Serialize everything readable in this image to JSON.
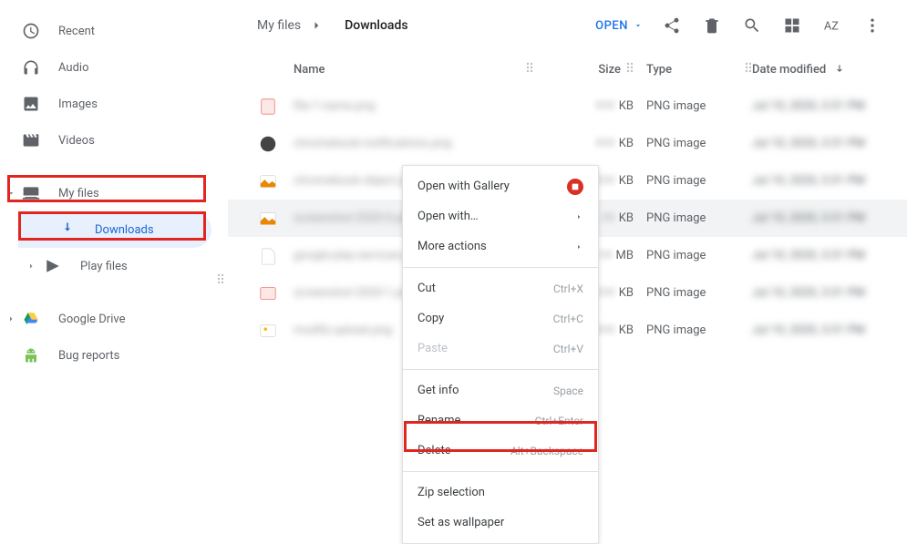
{
  "sidebar": {
    "recent": "Recent",
    "audio": "Audio",
    "images": "Images",
    "videos": "Videos",
    "myfiles": "My files",
    "downloads": "Downloads",
    "playfiles": "Play files",
    "gdrive": "Google Drive",
    "bugreports": "Bug reports"
  },
  "breadcrumb": {
    "root": "My files",
    "current": "Downloads"
  },
  "toolbar": {
    "open": "OPEN"
  },
  "columns": {
    "name": "Name",
    "size": "Size",
    "type": "Type",
    "date": "Date modified"
  },
  "files": [
    {
      "name": "file-1-name.png",
      "size_val": "000",
      "size_unit": "KB",
      "type": "PNG image",
      "date": "Jul 10, 2020, 3:31 PM"
    },
    {
      "name": "chromebook-notifications.png",
      "size_val": "000",
      "size_unit": "KB",
      "type": "PNG image",
      "date": "Jul 10, 2020, 3:31 PM"
    },
    {
      "name": "chromebook-object.png",
      "size_val": "000",
      "size_unit": "KB",
      "type": "PNG image",
      "date": "Jul 10, 2020, 3:31 PM"
    },
    {
      "name": "screenshot-2020-0.png",
      "size_val": "00",
      "size_unit": "KB",
      "type": "PNG image",
      "date": "Jul 10, 2020, 3:31 PM"
    },
    {
      "name": "google-play-services.png",
      "size_val": "00",
      "size_unit": "MB",
      "type": "PNG image",
      "date": "Jul 10, 2020, 3:31 PM"
    },
    {
      "name": "screenshot-2020-1.png",
      "size_val": "000",
      "size_unit": "KB",
      "type": "PNG image",
      "date": "Jul 10, 2020, 3:31 PM"
    },
    {
      "name": "modify-upload.png",
      "size_val": "000",
      "size_unit": "KB",
      "type": "PNG image",
      "date": "Jul 10, 2020, 3:31 PM"
    }
  ],
  "ctx": {
    "open_gallery": "Open with Gallery",
    "open_with": "Open with…",
    "more_actions": "More actions",
    "cut": "Cut",
    "cut_sc": "Ctrl+X",
    "copy": "Copy",
    "copy_sc": "Ctrl+C",
    "paste": "Paste",
    "paste_sc": "Ctrl+V",
    "getinfo": "Get info",
    "getinfo_sc": "Space",
    "rename": "Rename",
    "rename_sc": "Ctrl+Enter",
    "delete": "Delete",
    "delete_sc": "Alt+Backspace",
    "zip": "Zip selection",
    "wallpaper": "Set as wallpaper"
  }
}
